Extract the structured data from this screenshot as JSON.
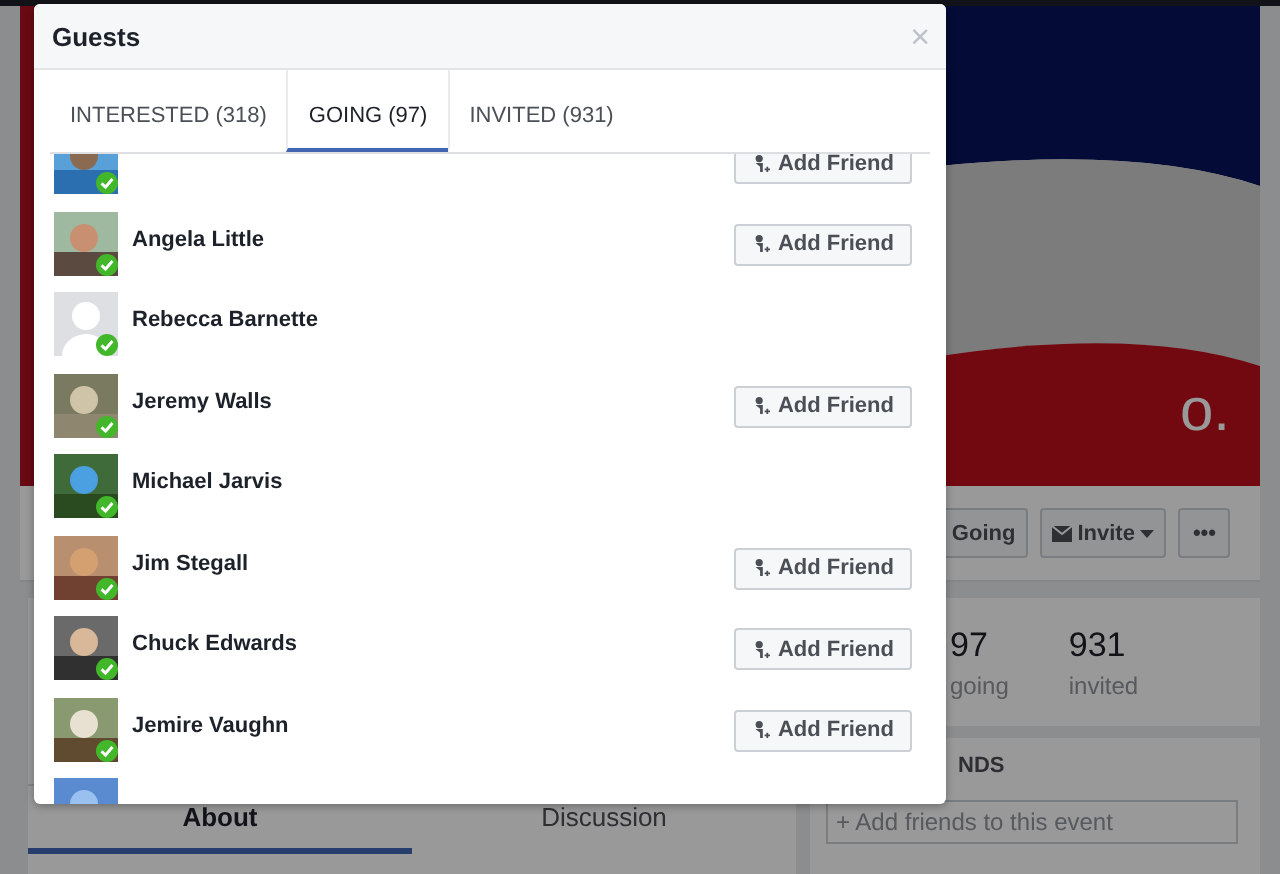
{
  "page": {
    "cover_text": "o.",
    "actions": [
      {
        "kind": "going",
        "label": "Going"
      },
      {
        "kind": "invite",
        "label": "Invite"
      },
      {
        "kind": "more",
        "label": "•••"
      }
    ],
    "stats": [
      {
        "value": "97",
        "label": "going"
      },
      {
        "value": "931",
        "label": "invited"
      }
    ],
    "friends_header": "NDS",
    "friends_field": {
      "placeholder": "+ Add friends to this event"
    },
    "tabs": [
      {
        "label": "About",
        "selected": true
      },
      {
        "label": "Discussion",
        "selected": false
      }
    ]
  },
  "dialog": {
    "title": "Guests",
    "close": "×",
    "tabs": [
      {
        "label": "INTERESTED (318)",
        "selected": false
      },
      {
        "label": "GOING (97)",
        "selected": true
      },
      {
        "label": "INVITED (931)",
        "selected": false
      }
    ],
    "guests": [
      {
        "kind": "picture",
        "going": true,
        "button": "Add Friend"
      },
      {
        "name": "Angela Little",
        "kind": "picture",
        "going": true,
        "button": "Add Friend"
      },
      {
        "name": "Rebecca Barnette",
        "kind": "default",
        "going": true
      },
      {
        "name": "Jeremy Walls",
        "kind": "picture",
        "going": true,
        "button": "Add Friend"
      },
      {
        "name": "Michael Jarvis",
        "kind": "picture",
        "going": true
      },
      {
        "name": "Jim Stegall",
        "kind": "picture",
        "going": true,
        "button": "Add Friend"
      },
      {
        "name": "Chuck Edwards",
        "kind": "picture",
        "going": true,
        "button": "Add Friend"
      },
      {
        "name": "Jemire Vaughn",
        "kind": "picture",
        "going": true,
        "button": "Add Friend"
      },
      {
        "kind": "picture"
      }
    ]
  }
}
